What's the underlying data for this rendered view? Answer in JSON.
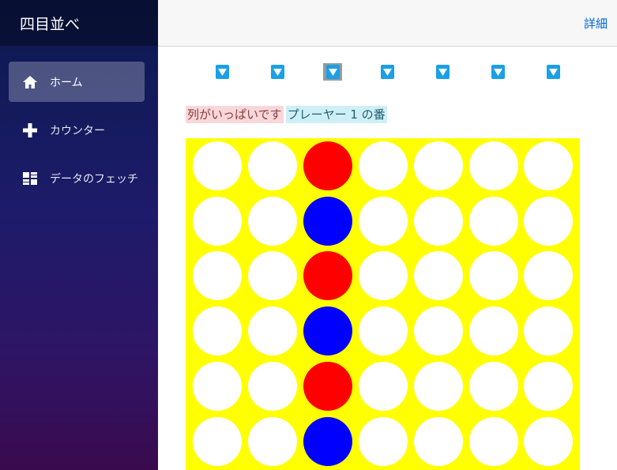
{
  "sidebar": {
    "brand": "四目並べ",
    "items": [
      {
        "label": "ホーム",
        "icon": "home-icon",
        "active": true
      },
      {
        "label": "カウンター",
        "icon": "plus-icon",
        "active": false
      },
      {
        "label": "データのフェッチ",
        "icon": "list-icon",
        "active": false
      }
    ]
  },
  "topbar": {
    "about_label": "詳細"
  },
  "game": {
    "columns": 7,
    "rows": 6,
    "selected_column": 2,
    "status_error": "列がいっぱいです",
    "status_turn": "プレーヤー 1 の番",
    "colors": {
      "board": "#ffff00",
      "empty": "#ffffff",
      "player1": "#ff0000",
      "player2": "#0000ff",
      "button": "#1aa0e6"
    },
    "grid": [
      [
        "",
        "",
        "R",
        "",
        "",
        "",
        ""
      ],
      [
        "",
        "",
        "B",
        "",
        "",
        "",
        ""
      ],
      [
        "",
        "",
        "R",
        "",
        "",
        "",
        ""
      ],
      [
        "",
        "",
        "B",
        "",
        "",
        "",
        ""
      ],
      [
        "",
        "",
        "R",
        "",
        "",
        "",
        ""
      ],
      [
        "",
        "",
        "B",
        "",
        "",
        "",
        ""
      ]
    ]
  }
}
